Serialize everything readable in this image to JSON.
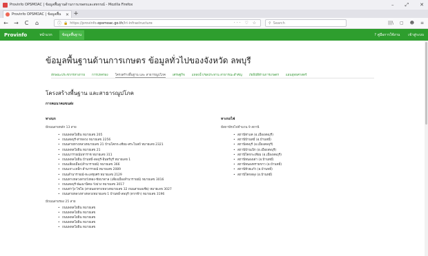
{
  "window": {
    "title": "Provinfo OPSMOAC | ข้อมูลพื้นฐานด้านการเกษตรและสหกรณ์ - Mozilla Firefox",
    "minimize": "–",
    "maximize": "⤢",
    "close": "✕"
  },
  "tab": {
    "label": "Provinfo OPSMOAC | ข้อมูลพื้น",
    "close": "✕",
    "new": "+"
  },
  "nav": {
    "back": "←",
    "forward": "→",
    "reload": "C",
    "home": "⌂",
    "url_prefix": "https://provinfo.",
    "url_domain": "opsmoac.go.th",
    "url_path": "/lri-infrastructure",
    "url_actions": "··· ♡ ☆",
    "search_placeholder": "Search",
    "toolbar_icons": [
      "|||\\",
      "▢",
      "☻",
      "≡"
    ]
  },
  "site": {
    "brand": "Provinfo",
    "nav": [
      {
        "label": "หน้าแรก",
        "active": false
      },
      {
        "label": "ข้อมูลพื้นฐาน",
        "active": true
      }
    ],
    "right": [
      "? คู่มือการใช้งาน",
      "เข้าสู่ระบบ"
    ]
  },
  "page": {
    "title": "ข้อมูลพื้นฐานด้านการเกษตร ข้อมูลทั่วไปของจังหวัด ลพบุรี",
    "subnav": [
      {
        "label": "ลักษณะประชากรทางกาย",
        "active": false
      },
      {
        "label": "การปกครอง",
        "active": false
      },
      {
        "label": "โครงสร้างพื้นฐาน และ สาธารณูปโภค",
        "active": true
      },
      {
        "label": "เศรษฐกิจ",
        "active": false
      },
      {
        "label": "แหล่งน้ำ/ชลประทาน สาธารณะสำคัญ",
        "active": false
      },
      {
        "label": "ภัยพิบัติด้านการเกษตร",
        "active": false
      },
      {
        "label": "แผนยุทธศาสตร์",
        "active": false
      }
    ],
    "heading": "โครงสร้างพื้นฐาน และสาธารณูปโภค",
    "subheading": "การคมนาคมขนส่ง",
    "left": {
      "title": "ทางบก",
      "sub": "มีถนนสายหลัก 13 สาย",
      "items": [
        "ถนนพหลโยธิน หมายเลข 205",
        "ถนนลพบุรี-ท่าหลวง หมายเลข 2256",
        "ถนนสายทางหลวงหมายเลข 21 บ้านโคกกะเทียม-สระโบสถ์ หมายเลข 2321",
        "ถนนพหลโยธิน หมายเลข 21",
        "ถนนนารายณ์มหาราช หมายเลข 311",
        "ถนนพหลโยธิน บ้านหมี่-ลพบุรี-อินทร์บุรี หมายเลข 1",
        "ถนนเลี่ยงเมือง(ลำนารายณ์) หมายเลข 366",
        "ถนนเจาะเหล็ก-ลำนารายณ์ หมายเลข 2089",
        "ถนนลำนารายณ์-ทะเลชุบศร หมายเลข 2129",
        "ถนนทางหลวงสายวังทอง-ชัยบาดาล (เลี่ยงเมืองลำนารายณ์) หมายเลข 3016",
        "ถนนลพบุรี-พัฒนานิคม-วังม่วง หมายเลข 3017",
        "ถนนท่าวุ้ง-ไชโย (สายนอกทางหลวงหมายเลข 32 ถนนสายเอเชีย) หมายเลข 3027",
        "ถนนสายหลวงทางหลวงหมายเลข 1 บ้านหมี่-ลพบุรี (ตากฟ้า) หมายเลข 3196"
      ],
      "sub2": "มีถนนสายรอง 25 สาย",
      "items2": [
        "ถนนพหลโยธิน หมายเลข",
        "ถนนพหลโยธิน หมายเลข",
        "ถนนพหลโยธิน หมายเลข",
        "ถนนพหลโยธิน หมายเลข",
        "ถนนพหลโยธิน หมายเลข"
      ]
    },
    "right": {
      "title": "ทางรถไฟ",
      "sub": "มีสถานีรถไฟจำนวน 9 สถานี",
      "items": [
        "สถานีท่าแค (อ.เมืองลพบุรี)",
        "สถานีบ้านหมี่ (อ.บ้านหมี่)",
        "สถานีลพบุรี (อ.เมืองลพบุรี)",
        "สถานีบ้านเบิก (อ.เมืองลพบุรี)",
        "สถานีโคกกะเทียม (อ.เมืองลพบุรี)",
        "สถานีหนองเต่า (อ.บ้านหมี่)",
        "สถานีหนองทรายขาว (อ.บ้านหมี่)",
        "สถานีห้วยแก้ว (อ.บ้านหมี่)",
        "สถานีโคกสลุง (อ.บ้านหมี่)"
      ]
    }
  },
  "colors": {
    "brand_green": "#2e9e2e",
    "nav_active": "#49b849",
    "subnav_link": "#3a9a3a"
  }
}
